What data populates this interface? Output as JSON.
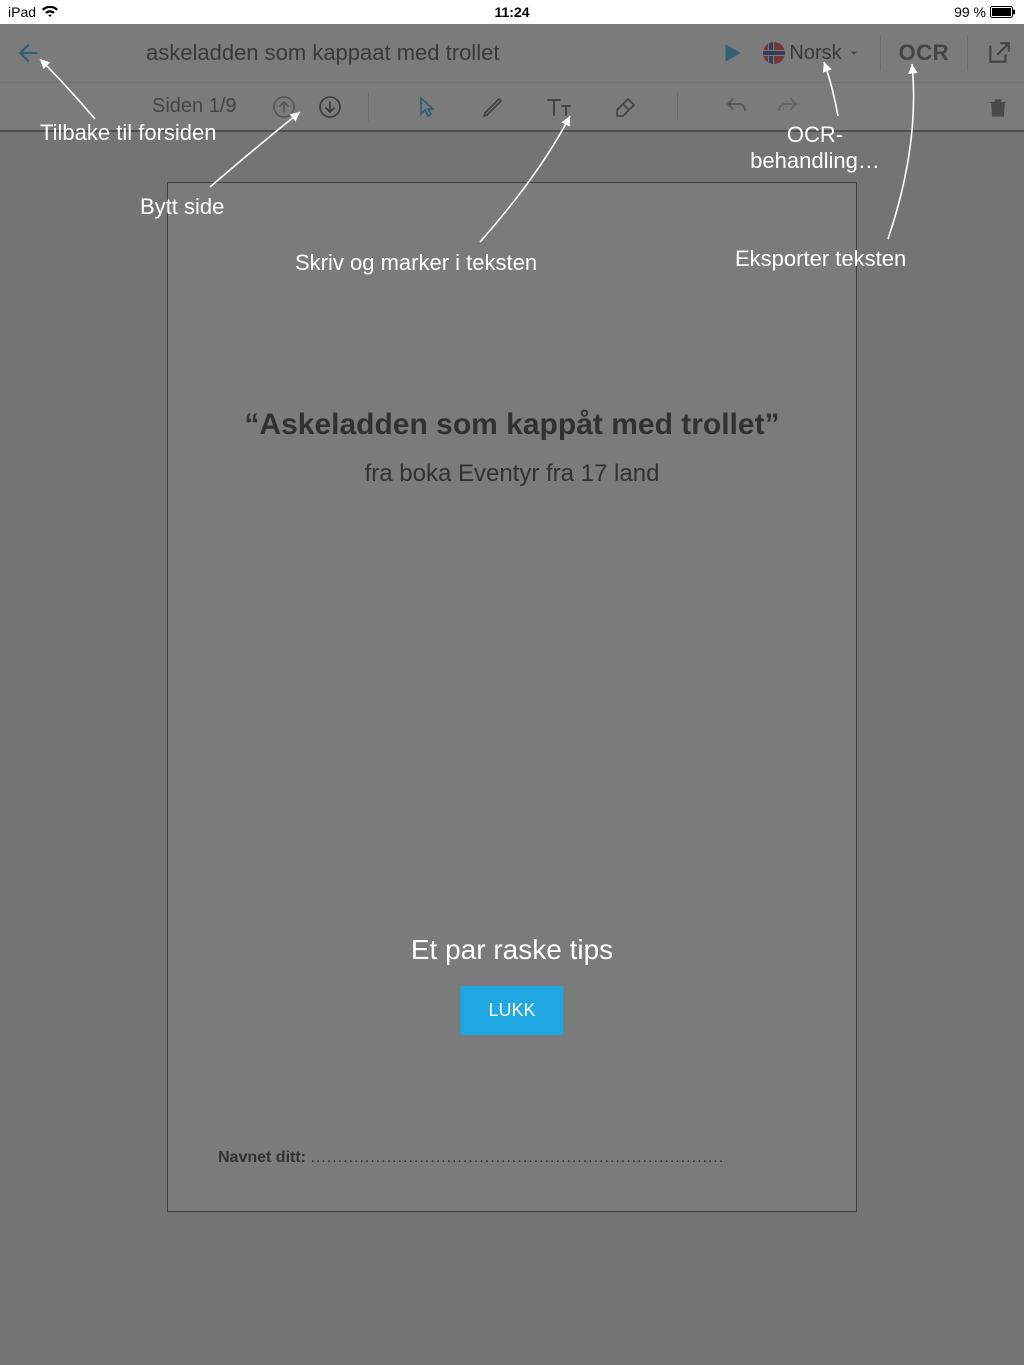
{
  "status": {
    "device": "iPad",
    "time": "11:24",
    "battery": "99 %"
  },
  "header": {
    "title": "askeladden som kappaat med trollet",
    "language": "Norsk",
    "ocr": "OCR"
  },
  "toolbar": {
    "page_indicator": "Siden 1/9"
  },
  "page": {
    "heading": "“Askeladden som kappåt med trollet”",
    "subheading": "fra boka Eventyr fra 17 land",
    "name_label": "Navnet ditt:",
    "name_dots": "............................................................................"
  },
  "tips": {
    "back": "Tilbake til forsiden",
    "page": "Bytt side",
    "write": "Skriv og marker i teksten",
    "ocr": "OCR-behandling…",
    "export": "Eksporter teksten",
    "title": "Et par raske tips",
    "close": "LUKK"
  }
}
